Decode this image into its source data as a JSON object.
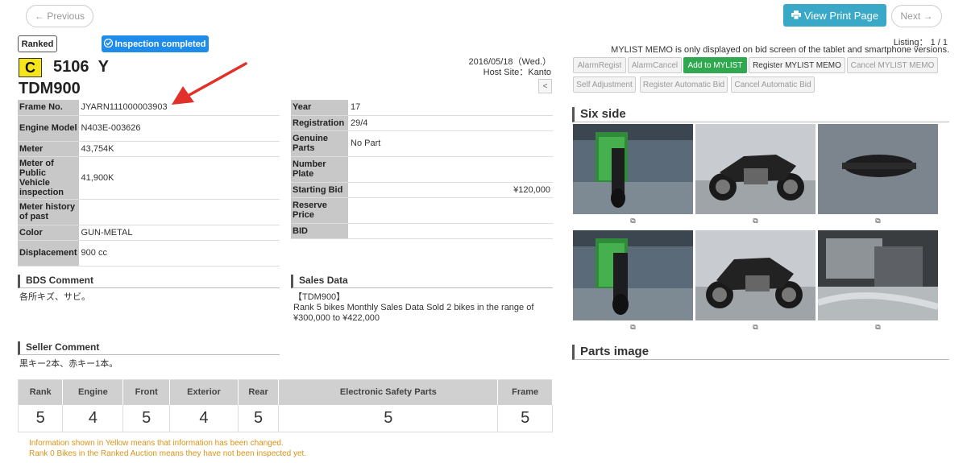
{
  "nav": {
    "previous_label": "← Previous",
    "next_label": "Next →",
    "print_label": "View Print Page",
    "print_icon": "printer-icon"
  },
  "header": {
    "ranked_badge": "Ranked",
    "inspection_badge": "Inspection completed",
    "grade_letter": "C",
    "lot_number": "5106",
    "lot_suffix": "Y",
    "model": "TDM900",
    "date": "2016/05/18（Wed.）",
    "host_site": "Host Site：Kanto",
    "collapse_label": "<"
  },
  "spec_left": [
    {
      "key": "Frame No.",
      "value": "JYARN111000003903"
    },
    {
      "key": "Engine Model",
      "value": "N403E-003626"
    },
    {
      "key": "Meter",
      "value": " 43,754K"
    },
    {
      "key": "Meter of Public Vehicle inspection",
      "value": "41,900K"
    },
    {
      "key": "Meter history of past",
      "value": ""
    },
    {
      "key": "Color",
      "value": "GUN-METAL"
    },
    {
      "key": "Displacement",
      "value": "900 cc"
    }
  ],
  "spec_right": [
    {
      "key": "Year",
      "value": "17"
    },
    {
      "key": "Registration",
      "value": "29/4"
    },
    {
      "key": "Genuine Parts",
      "value": "No Part"
    },
    {
      "key": "Number Plate",
      "value": ""
    },
    {
      "key": "Starting Bid",
      "value": "¥120,000"
    },
    {
      "key": "Reserve Price",
      "value": ""
    },
    {
      "key": "BID",
      "value": ""
    }
  ],
  "bds": {
    "title": "BDS Comment",
    "text": "各所キズ、サビ。"
  },
  "sales": {
    "title": "Sales Data",
    "line1": "【TDM900】",
    "line2": "Rank 5 bikes Monthly Sales Data Sold 2 bikes in the range of",
    "line3": "¥300,000 to ¥422,000"
  },
  "seller": {
    "title": "Seller Comment",
    "text": "黒キー2本、赤キー1本。"
  },
  "grades": {
    "headers": [
      "Rank",
      "Engine",
      "Front",
      "Exterior",
      "Rear",
      "Electronic Safety Parts",
      "Frame"
    ],
    "values": [
      "5",
      "4",
      "5",
      "4",
      "5",
      "5",
      "5"
    ]
  },
  "notes": {
    "yellow": "Information shown in Yellow means that information has been changed.",
    "rank0": "Rank 0 Bikes in the Ranked Auction means they have not been inspected yet."
  },
  "right_panel": {
    "listing": "Listing： 1 / 1",
    "mylist_memo": "MYLIST MEMO is only displayed on bid screen of the tablet and smartphone versions.",
    "buttons_row1": [
      "AlarmRegist",
      "AlarmCancel",
      "Add to MYLIST",
      "Register MYLIST MEMO",
      "Cancel MYLIST MEMO"
    ],
    "buttons_row2": [
      "Self Adjustment",
      "Register Automatic Bid",
      "Cancel Automatic Bid"
    ],
    "six_side_title": "Six side",
    "parts_title": "Parts image",
    "zoom_icon": "zoom-icon"
  },
  "colors": {
    "grade_yellow": "#f7e51c",
    "inspection_blue": "#1e8ce8",
    "print_teal": "#3aa9c8",
    "mylist_green": "#2fa84f",
    "note_orange": "#d9941a",
    "arrow_red": "#e0312a"
  }
}
